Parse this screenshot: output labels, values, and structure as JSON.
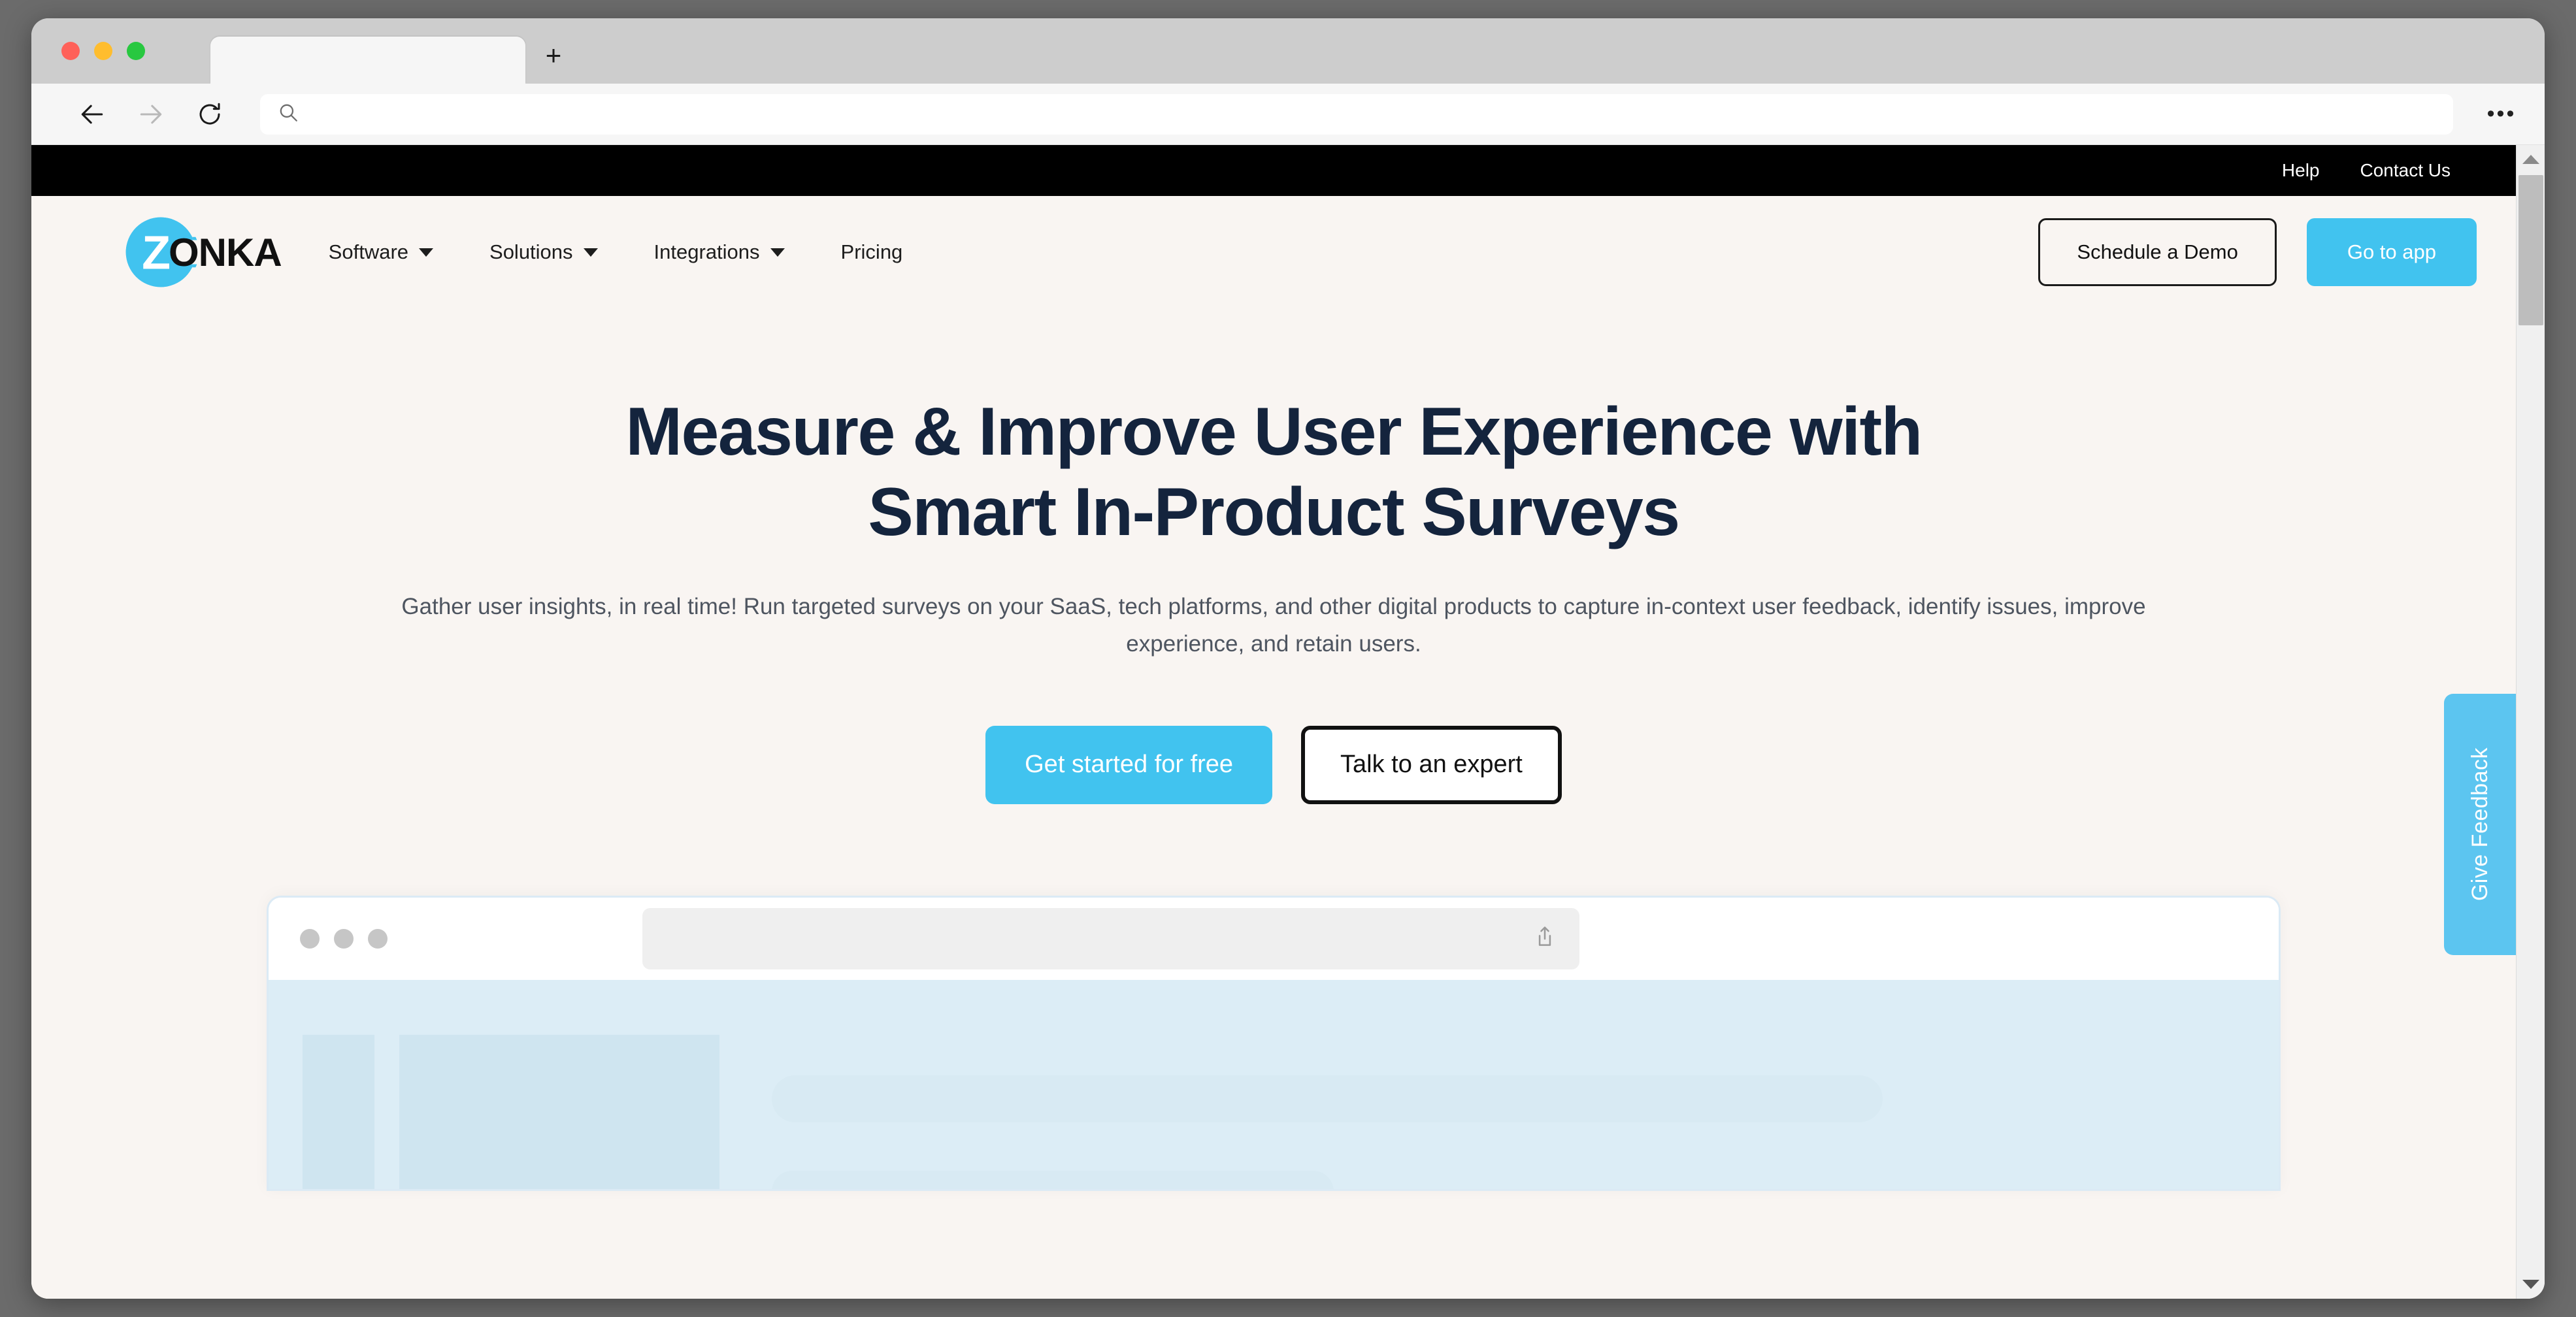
{
  "browser": {
    "tab_title": "",
    "new_tab_label": "+",
    "address_value": "",
    "address_placeholder": "",
    "menu_label": "•••",
    "traffic_lights": [
      "close",
      "minimize",
      "maximize"
    ],
    "icons": {
      "back": "back-arrow-icon",
      "forward": "forward-arrow-icon",
      "reload": "reload-icon",
      "search": "search-icon",
      "menu": "more-options-icon"
    }
  },
  "site": {
    "utility_bar": {
      "links": [
        {
          "label": "Help"
        },
        {
          "label": "Contact Us"
        }
      ]
    },
    "header": {
      "brand": {
        "mark_letter": "Z",
        "word": "ONKA",
        "mark_color": "#41c3ef"
      },
      "nav": [
        {
          "label": "Software",
          "has_dropdown": true
        },
        {
          "label": "Solutions",
          "has_dropdown": true
        },
        {
          "label": "Integrations",
          "has_dropdown": true
        },
        {
          "label": "Pricing",
          "has_dropdown": false
        }
      ],
      "actions": {
        "demo_label": "Schedule a Demo",
        "app_label": "Go to app"
      }
    },
    "hero": {
      "title_line_1": "Measure & Improve User Experience with",
      "title_line_2": "Smart In-Product Surveys",
      "subtitle_line_1": "Gather user insights, in real time! Run targeted surveys on your SaaS, tech platforms, and other digital products to capture",
      "subtitle_line_2": "in-context user feedback, identify issues, improve experience, and retain users.",
      "cta_primary": "Get started for free",
      "cta_secondary": "Talk to an expert"
    },
    "mockup": {
      "url_value": "",
      "share_icon": "share-icon"
    },
    "feedback_tab": {
      "label": "Give Feedback"
    }
  },
  "colors": {
    "brand_cyan": "#41c3ef",
    "feedback_cyan": "#5cc5f0",
    "page_background": "#f9f5f2",
    "headline_navy": "#14243d",
    "body_text": "#4e5560",
    "utility_bar": "#000000",
    "mockup_body": "#dcedf6"
  }
}
